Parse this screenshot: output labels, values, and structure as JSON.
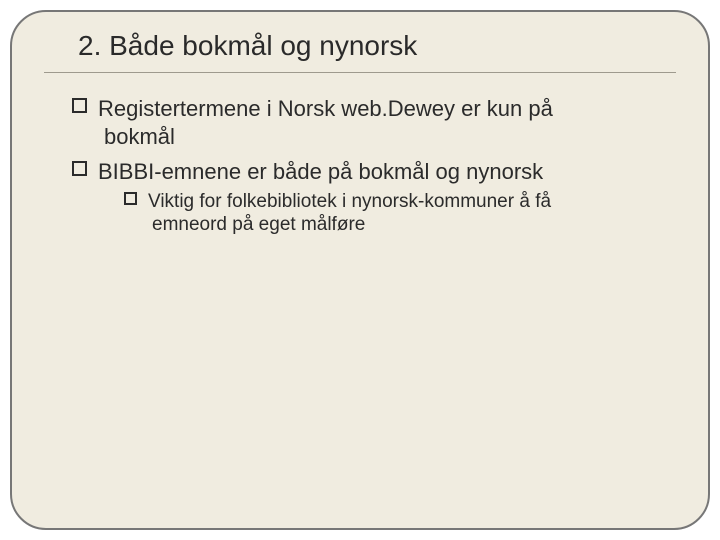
{
  "slide": {
    "title": "2. Både bokmål og nynorsk",
    "bullets": [
      {
        "line1": "Registertermene i Norsk web.Dewey er kun på",
        "line2": "bokmål"
      },
      {
        "line1": "BIBBI-emnene er både på bokmål og nynorsk",
        "sub": {
          "line1": "Viktig for folkebibliotek i nynorsk-kommuner å få",
          "line2": "emneord på eget målføre"
        }
      }
    ]
  }
}
